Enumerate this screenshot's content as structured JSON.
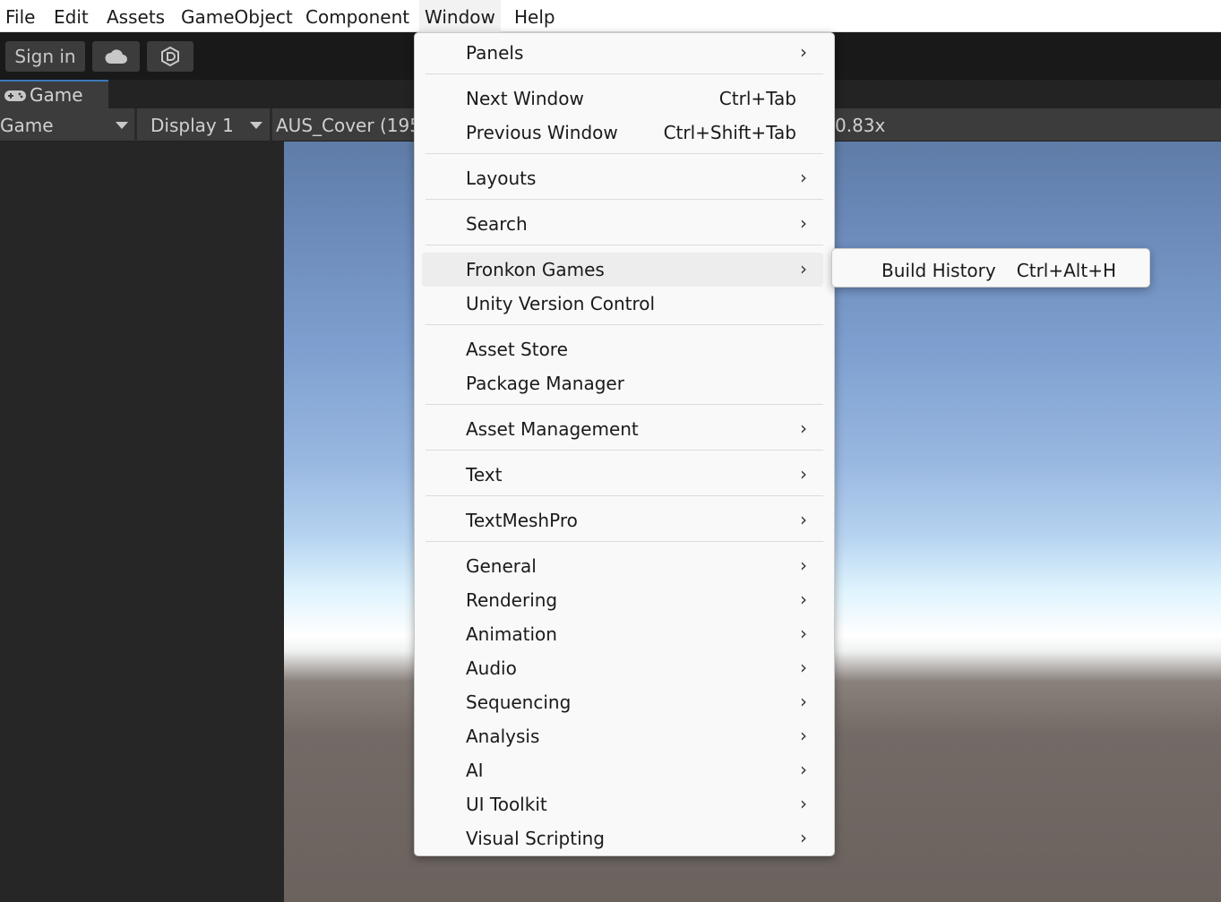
{
  "menubar": {
    "items": [
      {
        "label": "File"
      },
      {
        "label": "Edit"
      },
      {
        "label": "Assets"
      },
      {
        "label": "GameObject"
      },
      {
        "label": "Component"
      },
      {
        "label": "Window"
      },
      {
        "label": "Help"
      }
    ],
    "active": "Window"
  },
  "toolbar": {
    "sign_in_label": "Sign in",
    "cloud_icon": "cloud-icon",
    "services_icon": "unity-services-icon"
  },
  "game_tab": {
    "icon": "gamepad-icon",
    "label": "Game"
  },
  "game_bar": {
    "view_mode": "Game",
    "display": "Display 1",
    "resolution": "AUS_Cover (195",
    "scale": "0.83x"
  },
  "window_menu": {
    "items": [
      {
        "label": "Panels",
        "submenu": true
      },
      {
        "label": "Next Window",
        "shortcut": "Ctrl+Tab"
      },
      {
        "label": "Previous Window",
        "shortcut": "Ctrl+Shift+Tab"
      },
      {
        "label": "Layouts",
        "submenu": true
      },
      {
        "label": "Search",
        "submenu": true
      },
      {
        "label": "Fronkon Games",
        "submenu": true,
        "highlighted": true
      },
      {
        "label": "Unity Version Control"
      },
      {
        "label": "Asset Store"
      },
      {
        "label": "Package Manager"
      },
      {
        "label": "Asset Management",
        "submenu": true
      },
      {
        "label": "Text",
        "submenu": true
      },
      {
        "label": "TextMeshPro",
        "submenu": true
      },
      {
        "label": "General",
        "submenu": true
      },
      {
        "label": "Rendering",
        "submenu": true
      },
      {
        "label": "Animation",
        "submenu": true
      },
      {
        "label": "Audio",
        "submenu": true
      },
      {
        "label": "Sequencing",
        "submenu": true
      },
      {
        "label": "Analysis",
        "submenu": true
      },
      {
        "label": "AI",
        "submenu": true
      },
      {
        "label": "UI Toolkit",
        "submenu": true
      },
      {
        "label": "Visual Scripting",
        "submenu": true
      }
    ],
    "submenu_arrow": "›"
  },
  "fronkon_submenu": {
    "items": [
      {
        "label": "Build History",
        "shortcut": "Ctrl+Alt+H"
      }
    ]
  }
}
